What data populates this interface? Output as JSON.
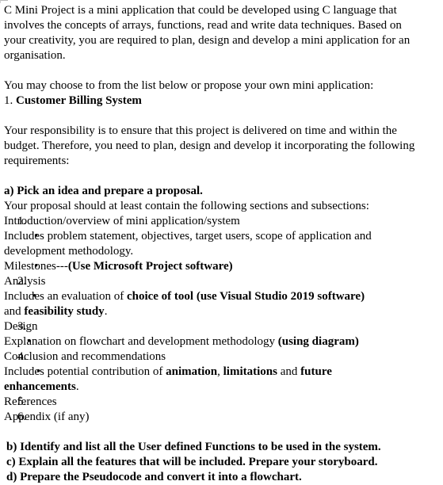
{
  "document": {
    "intro": {
      "line1": "C Mini Project is a mini application that could be developed using C language that",
      "line2": "involves the concepts of arrays, functions, read and write data techniques. Based on",
      "line3": "your creativity, you are required to plan, design and develop a mini application for an",
      "line4": "organisation."
    },
    "choose": {
      "prompt": "You may choose to from the list below or propose your own mini application:",
      "item_number": "1.",
      "item_label": "Customer Billing System"
    },
    "responsibility": {
      "line1": "Your responsibility is to ensure that this project is delivered on time and within the",
      "line2": "budget. Therefore, you need to plan, design and develop it incorporating the following",
      "line3": "requirements:"
    },
    "task_a": {
      "heading": "a) Pick an idea and prepare a proposal.",
      "lead": "Your proposal should at least contain the following sections and subsections:",
      "items": [
        {
          "number": "1.",
          "title": "Introduction/overview of mini application/system",
          "bullets": [
            {
              "bullet": "•",
              "line1": "Includes problem statement, objectives, target users, scope of application and",
              "line2": "development methodology."
            },
            {
              "bullet": "•",
              "text_regular": "Milestones---",
              "text_bold": "(Use Microsoft Project software)"
            }
          ]
        },
        {
          "number": "2.",
          "title": "Analysis",
          "bullets": [
            {
              "bullet": "•",
              "lead_regular": "Includes an evaluation of ",
              "lead_bold": "choice of tool (use Visual Studio 2019 software)",
              "cont_regular_1": "and ",
              "cont_bold": "feasibility study",
              "cont_regular_2": "."
            }
          ]
        },
        {
          "number": "3.",
          "title": "Design",
          "bullets": [
            {
              "bullet": "•",
              "text_regular": "Explanation on flowchart and development methodology ",
              "text_bold": "(using diagram)"
            }
          ]
        },
        {
          "number": "4.",
          "title": "Conclusion and recommendations",
          "bullets": [
            {
              "bullet": "•",
              "lead_regular_1": "Includes potential contribution of ",
              "lead_bold_1": "animation",
              "lead_regular_2": ", ",
              "lead_bold_2": "limitations",
              "lead_regular_3": " and ",
              "lead_bold_3": "future",
              "cont_bold": "enhancements",
              "cont_regular": "."
            }
          ]
        },
        {
          "number": "5.",
          "title": "References",
          "bullets": []
        },
        {
          "number": "6.",
          "title": "Appendix (if any)",
          "bullets": []
        }
      ]
    },
    "tasks_tail": {
      "b": "b) Identify and list all the User defined Functions to be used in the system.",
      "c": "c) Explain all the features that will be included. Prepare your storyboard.",
      "d": "d) Prepare the Pseudocode and convert it into a flowchart."
    }
  }
}
